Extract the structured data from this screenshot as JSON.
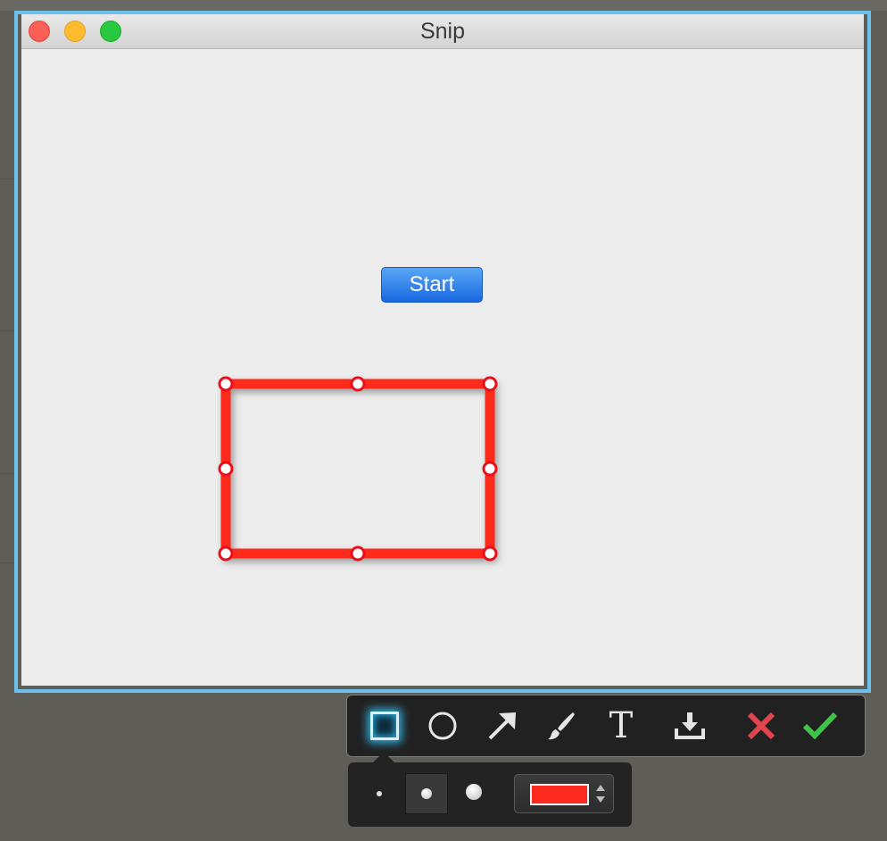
{
  "window": {
    "title": "Snip",
    "buttons": [
      "close",
      "minimize",
      "zoom"
    ]
  },
  "main": {
    "start_label": "Start"
  },
  "annotation": {
    "shape": "rectangle",
    "stroke_color": "#ff2a1f",
    "handle_count": 8
  },
  "toolbar": {
    "tools": [
      {
        "name": "rectangle-tool",
        "icon": "square-outline-icon",
        "selected": true
      },
      {
        "name": "ellipse-tool",
        "icon": "circle-outline-icon",
        "selected": false
      },
      {
        "name": "arrow-tool",
        "icon": "arrow-up-right-icon",
        "selected": false
      },
      {
        "name": "brush-tool",
        "icon": "brush-icon",
        "selected": false
      },
      {
        "name": "text-tool",
        "icon": "text-icon",
        "selected": false
      },
      {
        "name": "save-tool",
        "icon": "download-icon",
        "selected": false
      },
      {
        "name": "cancel-tool",
        "icon": "x-icon",
        "selected": false
      },
      {
        "name": "confirm-tool",
        "icon": "checkmark-icon",
        "selected": false
      }
    ],
    "text_tool_glyph": "T",
    "accent_color": "#35b4e6",
    "cancel_color": "#e0454e",
    "confirm_color": "#3fc44a"
  },
  "options": {
    "stroke_sizes": [
      "small",
      "medium",
      "large"
    ],
    "selected_size": "medium",
    "color": "#ff2a1f"
  }
}
